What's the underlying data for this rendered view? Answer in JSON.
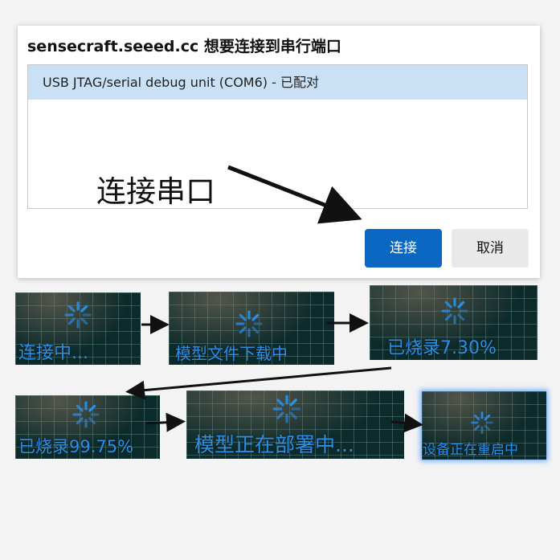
{
  "dialog": {
    "title": "sensecraft.seeed.cc 想要连接到串行端口",
    "ports": [
      "USB JTAG/serial debug unit (COM6) - 已配对"
    ],
    "annotation": "连接串口",
    "connect_label": "连接",
    "cancel_label": "取消",
    "selected_color": "#c9e0f5",
    "primary_color": "#0a67c2"
  },
  "steps": [
    {
      "caption": "连接中..."
    },
    {
      "caption": "模型文件下载中"
    },
    {
      "caption": "已烧录7.30%"
    },
    {
      "caption": "已烧录99.75%"
    },
    {
      "caption": "模型正在部署中..."
    },
    {
      "caption": "设备正在重启中"
    }
  ],
  "caption_color": "#2b8fe8"
}
